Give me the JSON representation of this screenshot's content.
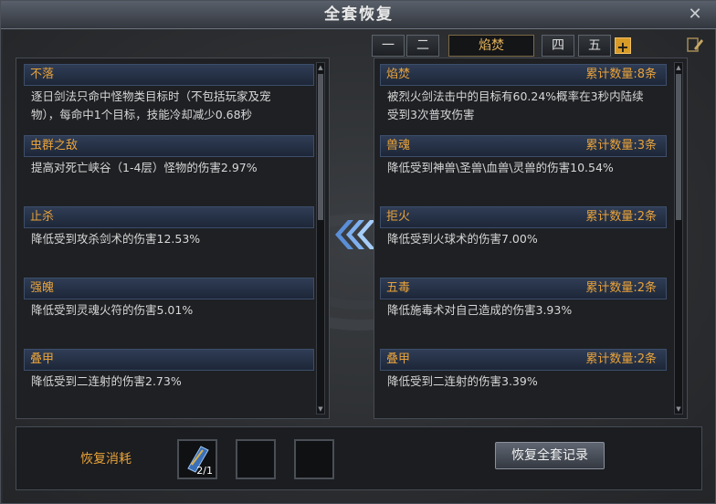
{
  "window": {
    "title": "全套恢复",
    "close_glyph": "✕"
  },
  "tabs": [
    "一",
    "二",
    "焰焚",
    "四",
    "五",
    "+"
  ],
  "left": {
    "entries": [
      {
        "name": "不落",
        "desc_lines": [
          "逐日剑法只命中怪物类目标时（不包括玩家及宠",
          "物），每命中1个目标，技能冷却减少0.68秒"
        ]
      },
      {
        "name": "虫群之敌",
        "desc_lines": [
          "提高对死亡峡谷（1-4层）怪物的伤害2.97%"
        ]
      },
      {
        "name": "止杀",
        "desc_lines": [
          "降低受到攻杀剑术的伤害12.53%"
        ]
      },
      {
        "name": "强魄",
        "desc_lines": [
          "降低受到灵魂火符的伤害5.01%"
        ]
      },
      {
        "name": "叠甲",
        "desc_lines": [
          "降低受到二连射的伤害2.73%"
        ]
      }
    ]
  },
  "right": {
    "entries": [
      {
        "name": "焰焚",
        "count": "累计数量:8条",
        "desc_lines": [
          "被烈火剑法击中的目标有60.24%概率在3秒内陆续",
          "受到3次普攻伤害"
        ]
      },
      {
        "name": "兽魂",
        "count": "累计数量:3条",
        "desc_lines": [
          "降低受到神兽\\圣兽\\血兽\\灵兽的伤害10.54%"
        ]
      },
      {
        "name": "拒火",
        "count": "累计数量:2条",
        "desc_lines": [
          "降低受到火球术的伤害7.00%"
        ]
      },
      {
        "name": "五毒",
        "count": "累计数量:2条",
        "desc_lines": [
          "降低施毒术对自己造成的伤害3.93%"
        ]
      },
      {
        "name": "叠甲",
        "count": "累计数量:2条",
        "desc_lines": [
          "降低受到二连射的伤害3.39%"
        ]
      }
    ]
  },
  "bottom": {
    "cost_label": "恢复消耗",
    "item_count": "2/1",
    "restore_button": "恢复全套记录"
  },
  "colors": {
    "accent": "#e8a23a",
    "header_blue": "#2f3d55",
    "text": "#d7d7d7"
  },
  "icons": [
    "close-icon",
    "edit-pencil-icon",
    "transfer-arrows-icon",
    "scroll-item-icon"
  ]
}
